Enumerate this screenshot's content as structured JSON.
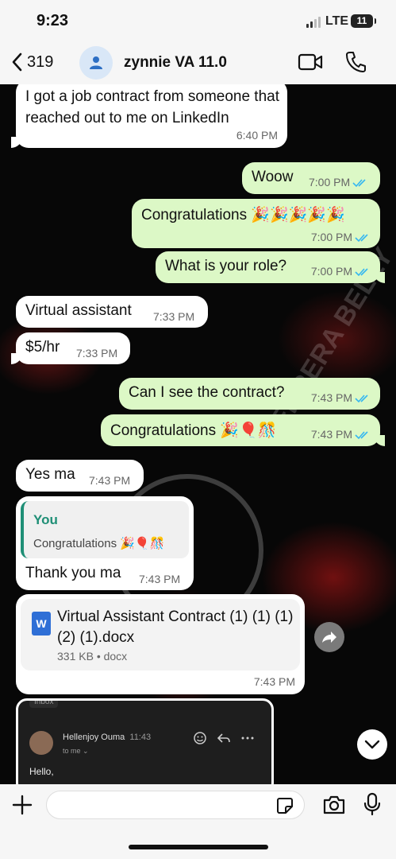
{
  "status": {
    "time": "9:23",
    "network": "LTE",
    "battery": "11"
  },
  "header": {
    "back_count": "319",
    "contact_name": "zynnie VA 11.0"
  },
  "messages": [
    {
      "dir": "in",
      "text": "I got a job contract from someone that reached out to me on LinkedIn",
      "time": "6:40 PM"
    },
    {
      "dir": "out",
      "text": "Woow",
      "time": "7:00 PM"
    },
    {
      "dir": "out",
      "text": "Congratulations 🎉🎉🎉🎉🎉",
      "time": "7:00 PM"
    },
    {
      "dir": "out",
      "text": "What is your role?",
      "time": "7:00 PM"
    },
    {
      "dir": "in",
      "text": "Virtual assistant",
      "time": "7:33 PM"
    },
    {
      "dir": "in",
      "text": "$5/hr",
      "time": "7:33 PM"
    },
    {
      "dir": "out",
      "text": "Can I see the contract?",
      "time": "7:43 PM"
    },
    {
      "dir": "out",
      "text": "Congratulations 🎉🎈🎊",
      "time": "7:43 PM"
    },
    {
      "dir": "in",
      "text": "Yes ma",
      "time": "7:43 PM"
    },
    {
      "dir": "in",
      "text": "Thank you ma",
      "time": "7:43 PM",
      "reply_to": {
        "sender": "You",
        "text": "Congratulations 🎉🎈🎊"
      }
    },
    {
      "dir": "in",
      "type": "document",
      "file_name": "Virtual Assistant Contract (1) (1) (1) (2) (1).docx",
      "file_meta": "331 KB • docx",
      "doc_icon_letter": "W",
      "time": "7:43 PM"
    }
  ],
  "image_message": {
    "folder_label": "Inbox",
    "sender": "Hellenjoy Ouma",
    "time": "11:43",
    "to_label": "to me",
    "greeting": "Hello,"
  },
  "watermark_text": "HERRERA BELLY",
  "composer": {
    "placeholder": ""
  },
  "colors": {
    "incoming": "#ffffff",
    "outgoing": "#dcf8c6",
    "accent": "#1f8f76",
    "tick": "#34b7f1"
  }
}
